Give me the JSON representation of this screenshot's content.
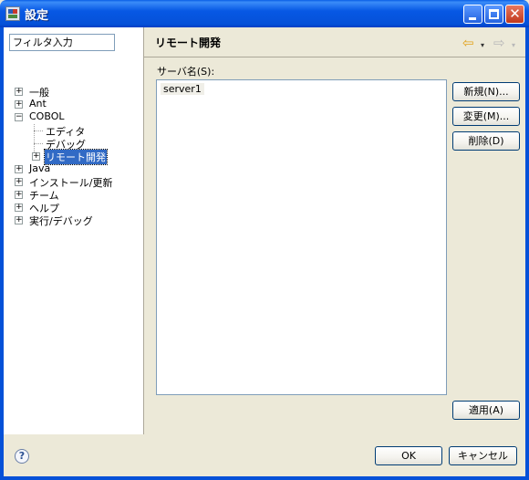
{
  "window": {
    "title": "設定",
    "close_glyph": "✕"
  },
  "filter": {
    "value": "フィルタ入力"
  },
  "tree": {
    "expand_symbol": "+",
    "collapse_symbol": "−",
    "items": [
      {
        "label": "一般"
      },
      {
        "label": "Ant"
      },
      {
        "label": "COBOL"
      },
      {
        "label": "エディタ"
      },
      {
        "label": "デバッグ"
      },
      {
        "label": "リモート開発"
      },
      {
        "label": "Java"
      },
      {
        "label": "インストール/更新"
      },
      {
        "label": "チーム"
      },
      {
        "label": "ヘルプ"
      },
      {
        "label": "実行/デバッグ"
      }
    ]
  },
  "page": {
    "title": "リモート開発",
    "nav_back_glyph": "⇦",
    "nav_forward_glyph": "⇨",
    "dropdown_glyph": "▾"
  },
  "server": {
    "label": "サーバ名(S):",
    "items": [
      "server1"
    ]
  },
  "buttons": {
    "new": "新規(N)...",
    "edit": "変更(M)...",
    "delete": "削除(D)",
    "apply": "適用(A)",
    "ok": "OK",
    "cancel": "キャンセル"
  },
  "help": {
    "glyph": "?"
  },
  "icons": {
    "app": "preferences-icon",
    "back": "back-arrow-icon",
    "forward": "forward-arrow-icon",
    "help": "help-icon"
  },
  "colors": {
    "titlebar": "#0551d8",
    "selection": "#316ac5",
    "back_arrow": "#e2a21a"
  }
}
